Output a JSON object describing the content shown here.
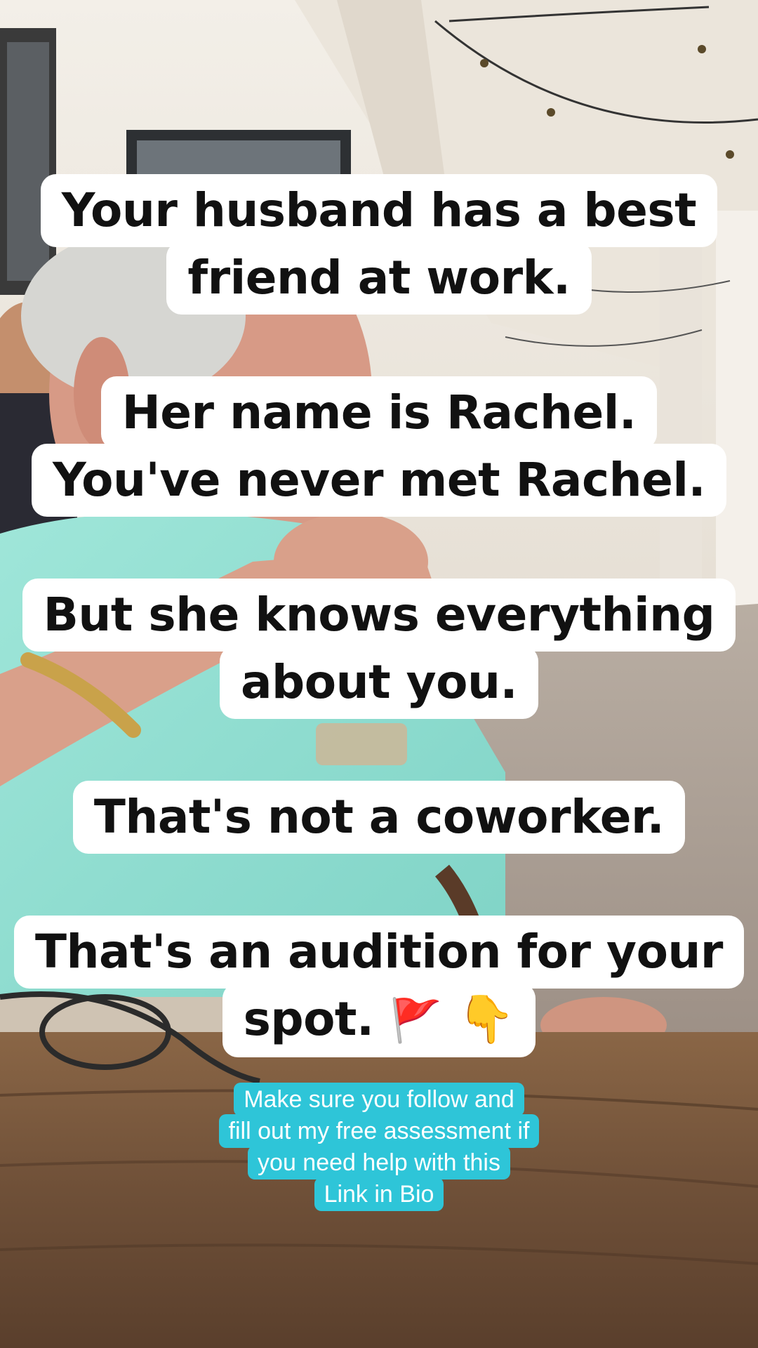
{
  "captions": [
    {
      "lines": [
        "Your husband has a best",
        "friend at work."
      ]
    },
    {
      "lines": [
        "Her name is Rachel.",
        "You've never met Rachel."
      ]
    },
    {
      "lines": [
        "But she knows everything",
        "about you."
      ]
    },
    {
      "lines": [
        "That's not a coworker."
      ]
    },
    {
      "lines": [
        "That's an audition for your",
        "spot."
      ],
      "emoji": [
        "red-flag",
        "backhand-index-pointing-down"
      ],
      "emoji_chars": [
        "🚩",
        "👇"
      ]
    }
  ],
  "cta": {
    "lines": [
      "Make sure you follow and",
      "fill out my free assessment if",
      "you need help with this",
      "Link in Bio"
    ],
    "color": "#2ec5d8"
  },
  "colors": {
    "caption_bg": "#ffffff",
    "caption_text": "#111111"
  }
}
